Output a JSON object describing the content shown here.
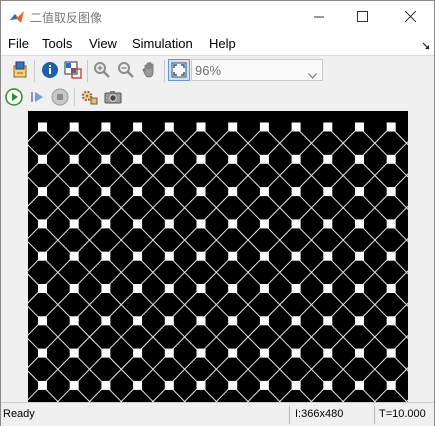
{
  "window": {
    "title": "二值取反图像"
  },
  "menu": [
    "File",
    "Tools",
    "View",
    "Simulation",
    "Help"
  ],
  "toolbar": {
    "zoom_value": "96%"
  },
  "status": {
    "state": "Ready",
    "size": "I:366x480",
    "time": "T=10.000"
  },
  "icons": {
    "app": "matlab-icon",
    "minimize": "minimize-icon",
    "maximize": "maximize-icon",
    "close": "close-icon",
    "menubar_overflow": "arrow-icon",
    "tb1": [
      "open-block-icon",
      "info-icon",
      "pixel-region-icon",
      "zoom-in-icon",
      "zoom-out-icon",
      "pan-icon",
      "fit-to-window-icon"
    ],
    "tb2": [
      "run-icon",
      "step-forward-icon",
      "stop-icon",
      "settings-icon",
      "snapshot-icon"
    ]
  },
  "colors": {
    "run_green": "#2e8b2e",
    "accent_blue": "#1f5fa8",
    "image_bg": "#000000",
    "pattern": "#ffffff"
  }
}
